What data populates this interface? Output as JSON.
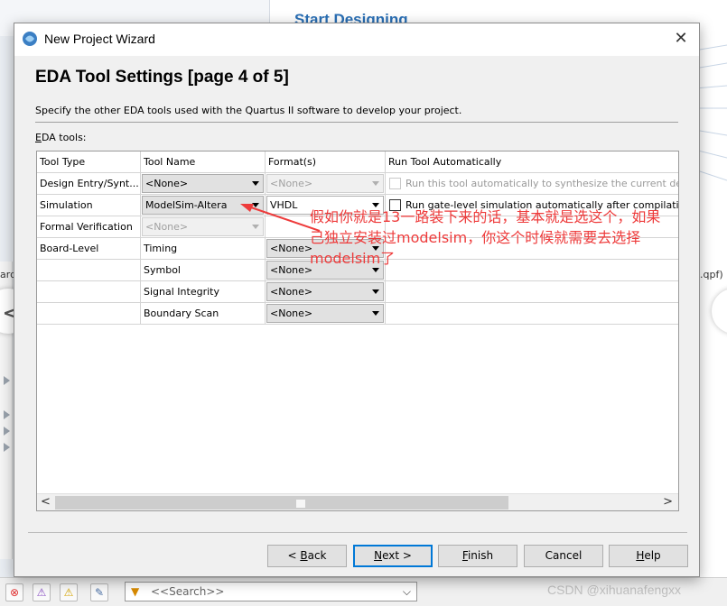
{
  "background": {
    "heading": "Start Designing",
    "left_fragment": "ard",
    "right_fragment": ".qpf)"
  },
  "dialog": {
    "title": "New Project Wizard",
    "page_title": "EDA Tool Settings [page 4 of 5]",
    "description": "Specify the other EDA tools used with the Quartus II software to develop your project.",
    "eda_label_prefix": "E",
    "eda_label_rest": "DA tools:",
    "columns": [
      "Tool Type",
      "Tool Name",
      "Format(s)",
      "Run Tool Automatically"
    ],
    "rows": [
      {
        "type": "Design Entry/Synt...",
        "name": "<None>",
        "format": "<None>",
        "auto": "Run this tool automatically to synthesize the current desi"
      },
      {
        "type": "Simulation",
        "name": "ModelSim-Altera",
        "format": "VHDL",
        "auto": "Run gate-level simulation automatically after compilation"
      },
      {
        "type": "Formal Verification",
        "name": "<None>",
        "format": "",
        "auto": ""
      },
      {
        "type": "Board-Level",
        "name": "Timing",
        "format": "<None>",
        "auto": ""
      },
      {
        "type": "",
        "name": "Symbol",
        "format": "<None>",
        "auto": ""
      },
      {
        "type": "",
        "name": "Signal Integrity",
        "format": "<None>",
        "auto": ""
      },
      {
        "type": "",
        "name": "Boundary Scan",
        "format": "<None>",
        "auto": ""
      }
    ],
    "annotation": [
      "假如你就是13一路装下来的话，基本就是选这个，如果",
      "己独立安装过modelsim，你这个时候就需要去选择",
      "modelsim了"
    ],
    "buttons": {
      "back": {
        "pre": "< ",
        "u": "B",
        "post": "ack"
      },
      "next": {
        "pre": "",
        "u": "N",
        "post": "ext >"
      },
      "finish": {
        "pre": "",
        "u": "F",
        "post": "inish"
      },
      "cancel": {
        "pre": "",
        "u": "",
        "post": "Cancel"
      },
      "help": {
        "pre": "",
        "u": "H",
        "post": "elp"
      }
    }
  },
  "statusbar": {
    "search_placeholder": "<<Search>>"
  },
  "watermark": "CSDN @xihuanafengxx",
  "colors": {
    "annotation": "#ee3b3b",
    "default_button_border": "#0078d7",
    "bg_heading": "#2a6fb5"
  }
}
